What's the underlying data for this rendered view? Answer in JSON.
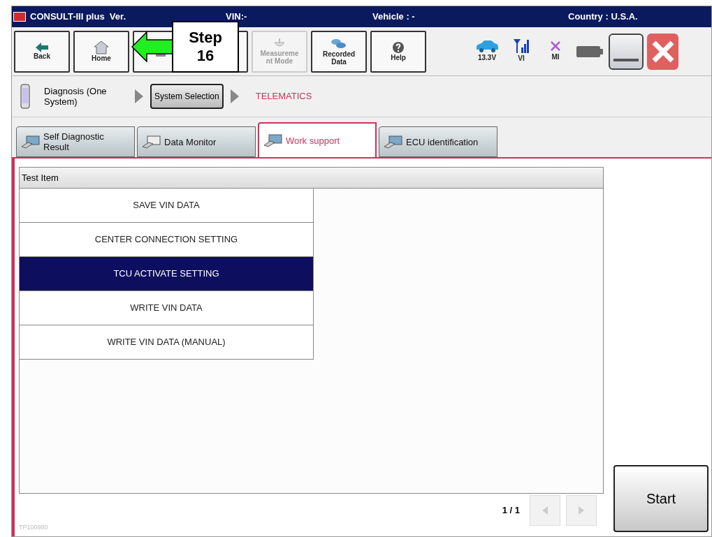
{
  "title_bar": {
    "app": "CONSULT-III plus  Ver.",
    "vin": "VIN:-",
    "vehicle": "Vehicle : -",
    "country": "Country : U.S.A."
  },
  "toolbar": [
    {
      "kind": "back",
      "lines": [
        "Back"
      ],
      "disabled": false
    },
    {
      "kind": "home",
      "lines": [
        "Home"
      ],
      "disabled": false
    },
    {
      "kind": "print",
      "disabled": false
    },
    {
      "kind": "capture",
      "disabled": false
    },
    {
      "kind": "measure",
      "lines": [
        "Measureme",
        "nt Mode"
      ],
      "disabled": true
    },
    {
      "kind": "recorded",
      "lines": [
        "Recorded",
        "Data"
      ],
      "disabled": false
    },
    {
      "kind": "help",
      "lines": [
        "Help"
      ],
      "disabled": false
    }
  ],
  "status": [
    {
      "kind": "car",
      "label": "13.3V"
    },
    {
      "kind": "signal",
      "label": "VI"
    },
    {
      "kind": "cross",
      "label": "MI"
    },
    {
      "kind": "battery"
    }
  ],
  "callout": {
    "text": "Step\n16"
  },
  "breadcrumb": {
    "mode": "Diagnosis (One System)",
    "step": "System Selection",
    "current": "TELEMATICS"
  },
  "tabs": [
    {
      "label": "Self Diagnostic Result",
      "selected": false
    },
    {
      "label": "Data Monitor",
      "selected": false
    },
    {
      "label": "Work support",
      "selected": true
    },
    {
      "label": "ECU identification",
      "selected": false
    }
  ],
  "table": {
    "header": "Test Item",
    "rows": [
      {
        "label": "SAVE VIN DATA",
        "selected": false
      },
      {
        "label": "CENTER CONNECTION SETTING",
        "selected": false
      },
      {
        "label": "TCU ACTIVATE SETTING",
        "selected": true
      },
      {
        "label": "WRITE VIN DATA",
        "selected": false
      },
      {
        "label": "WRITE VIN DATA (MANUAL)",
        "selected": false
      }
    ]
  },
  "pager": "1 / 1",
  "start_button": "Start",
  "figure_id": "TP100980"
}
